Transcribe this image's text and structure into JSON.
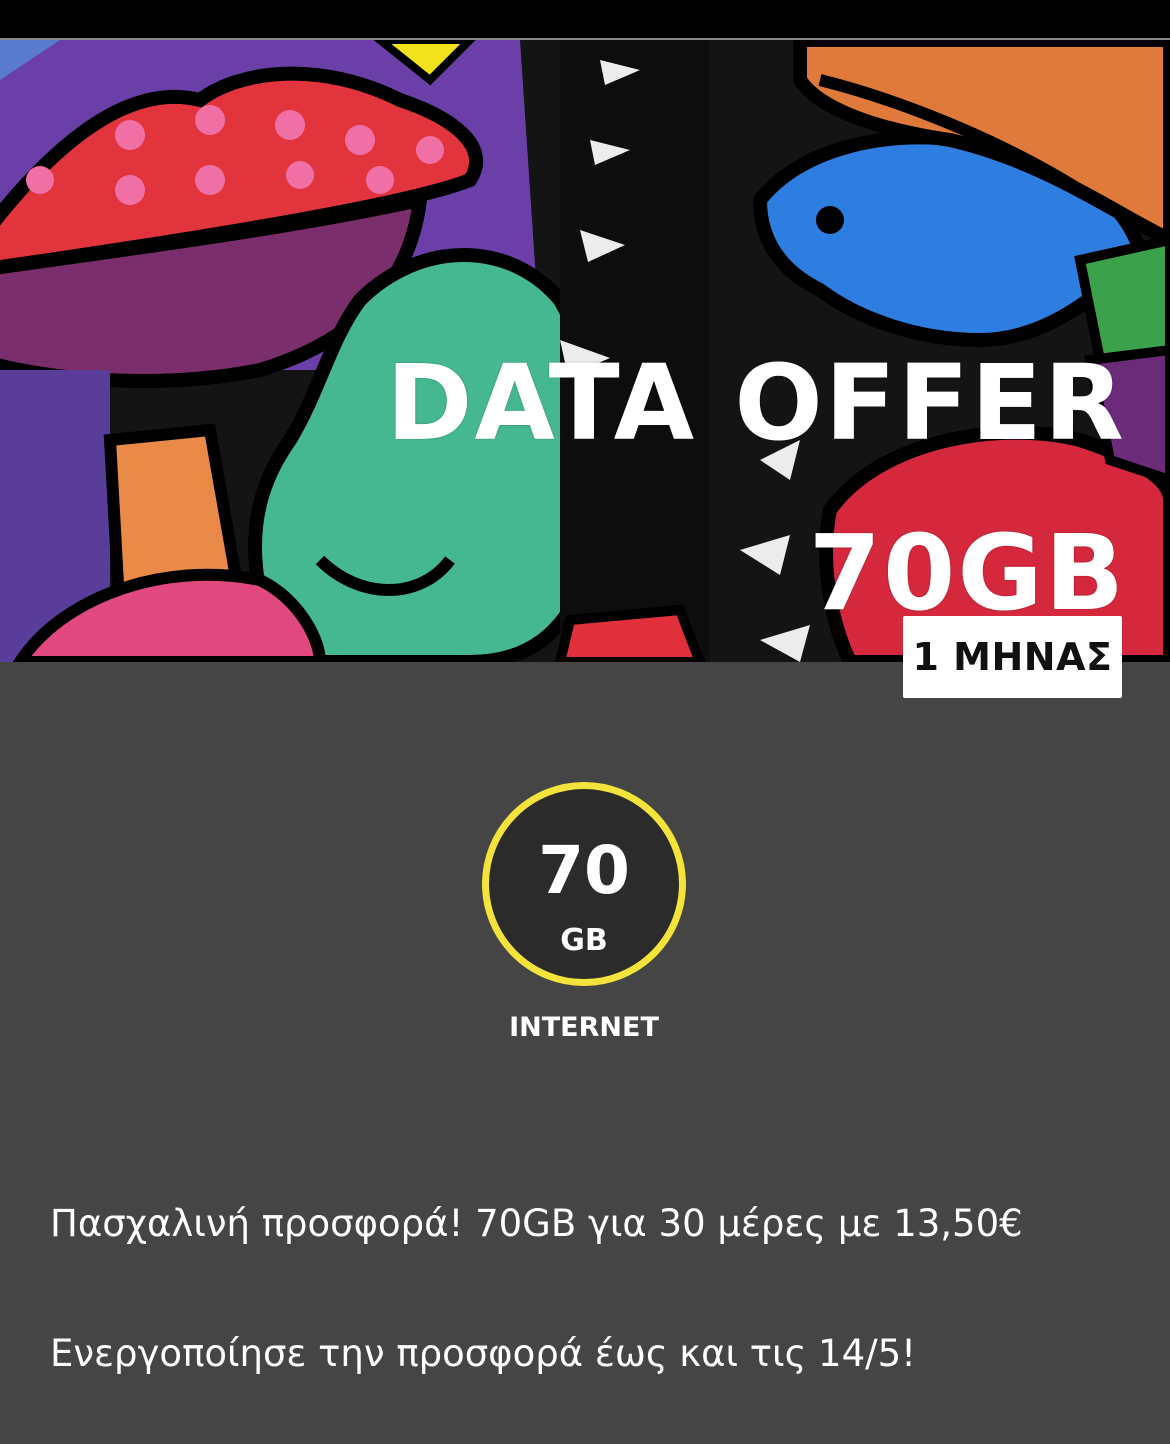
{
  "offer": {
    "title_line1": "DATA OFFER",
    "title_line2": "70GB",
    "duration": "1 ΜΗΝΑΣ"
  },
  "data_allowance": {
    "amount": "70",
    "unit": "GB",
    "label": "INTERNET"
  },
  "description": {
    "line1": "Πασχαλινή προσφορά! 70GB για 30 μέρες με 13,50€",
    "line2": "Ενεργοποίησε την προσφορά έως και τις 14/5!"
  },
  "colors": {
    "background": "#454545",
    "ring": "#f4e33a",
    "badge": "#ffffff"
  }
}
